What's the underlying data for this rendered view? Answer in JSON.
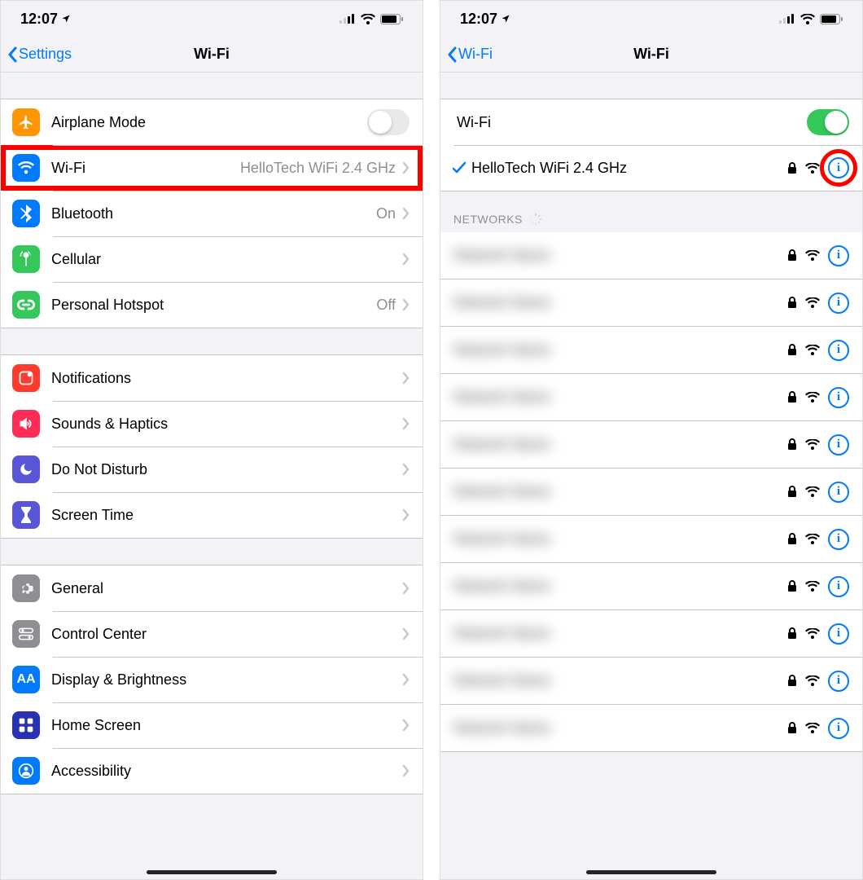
{
  "status": {
    "time": "12:07"
  },
  "left": {
    "back": "Settings",
    "title": "Wi-Fi",
    "rows_connectivity": [
      {
        "key": "airplane",
        "label": "Airplane Mode",
        "value": "",
        "color": "#ff9500",
        "icon": "airplane"
      },
      {
        "key": "wifi",
        "label": "Wi-Fi",
        "value": "HelloTech WiFi 2.4 GHz",
        "color": "#007aff",
        "icon": "wifi",
        "hl": true
      },
      {
        "key": "bluetooth",
        "label": "Bluetooth",
        "value": "On",
        "color": "#007aff",
        "icon": "bluetooth"
      },
      {
        "key": "cellular",
        "label": "Cellular",
        "value": "",
        "color": "#34c759",
        "icon": "antenna"
      },
      {
        "key": "hotspot",
        "label": "Personal Hotspot",
        "value": "Off",
        "color": "#34c759",
        "icon": "link"
      }
    ],
    "rows_notifications": [
      {
        "key": "notifications",
        "label": "Notifications",
        "color": "#ff3b30",
        "icon": "bell"
      },
      {
        "key": "sounds",
        "label": "Sounds & Haptics",
        "color": "#ff2d55",
        "icon": "speaker"
      },
      {
        "key": "dnd",
        "label": "Do Not Disturb",
        "color": "#5856d6",
        "icon": "moon"
      },
      {
        "key": "screentime",
        "label": "Screen Time",
        "color": "#5856d6",
        "icon": "hourglass"
      }
    ],
    "rows_general": [
      {
        "key": "general",
        "label": "General",
        "color": "#8e8e93",
        "icon": "gear"
      },
      {
        "key": "control",
        "label": "Control Center",
        "color": "#8e8e93",
        "icon": "switches"
      },
      {
        "key": "display",
        "label": "Display & Brightness",
        "color": "#007aff",
        "icon": "aa"
      },
      {
        "key": "home",
        "label": "Home Screen",
        "color": "#2832b3",
        "icon": "grid"
      },
      {
        "key": "accessibility",
        "label": "Accessibility",
        "color": "#007aff",
        "icon": "person"
      }
    ]
  },
  "right": {
    "back": "Wi-Fi",
    "title": "Wi-Fi",
    "toggle_label": "Wi-Fi",
    "toggle_on": true,
    "connected": "HelloTech WiFi 2.4 GHz",
    "section": "NETWORKS",
    "networks_count": 11
  }
}
